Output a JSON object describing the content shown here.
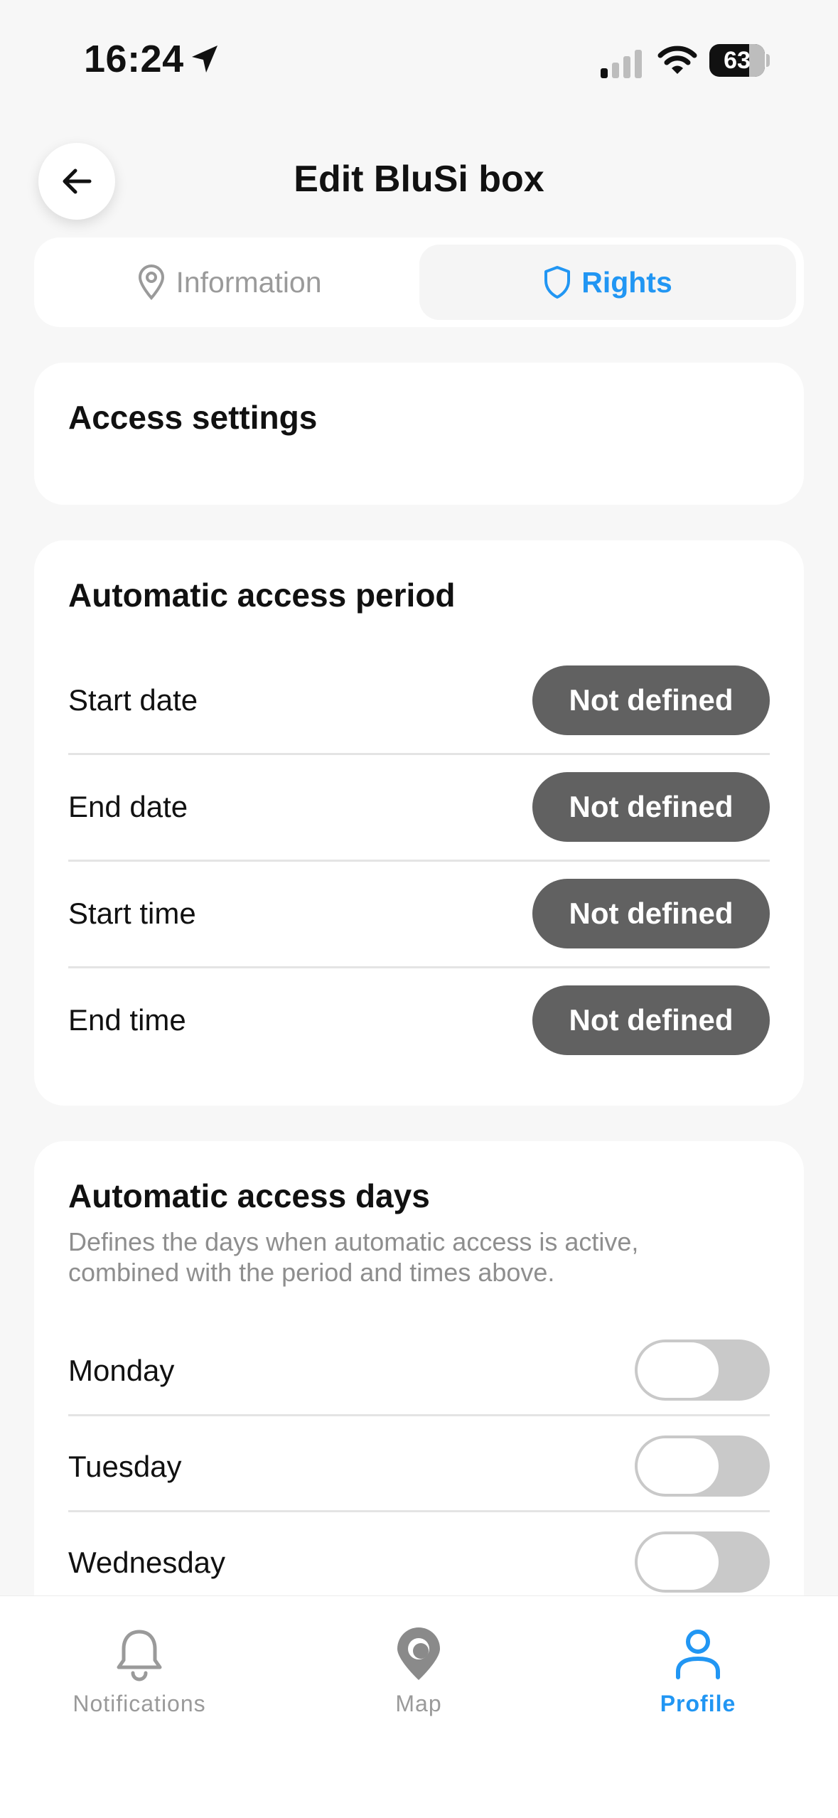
{
  "status_bar": {
    "time": "16:24",
    "battery": "63"
  },
  "header": {
    "title": "Edit BluSi box"
  },
  "tabs": [
    {
      "label": "Information",
      "active": false
    },
    {
      "label": "Rights",
      "active": true
    }
  ],
  "access_settings": {
    "title": "Access settings"
  },
  "access_period": {
    "title": "Automatic access period",
    "rows": [
      {
        "label": "Start date",
        "value": "Not defined"
      },
      {
        "label": "End date",
        "value": "Not defined"
      },
      {
        "label": "Start time",
        "value": "Not defined"
      },
      {
        "label": "End time",
        "value": "Not defined"
      }
    ]
  },
  "access_days": {
    "title": "Automatic access days",
    "description": "Defines the days when automatic access is active, combined with the period and times above.",
    "days": [
      {
        "label": "Monday",
        "enabled": false
      },
      {
        "label": "Tuesday",
        "enabled": false
      },
      {
        "label": "Wednesday",
        "enabled": false
      }
    ]
  },
  "bottom_nav": {
    "items": [
      {
        "label": "Notifications",
        "icon": "bell-icon",
        "active": false
      },
      {
        "label": "Map",
        "icon": "map-pin-icon",
        "active": false
      },
      {
        "label": "Profile",
        "icon": "profile-icon",
        "active": true
      }
    ]
  },
  "colors": {
    "accent": "#2196f3",
    "pill": "#616161",
    "inactive": "#9a9a9a"
  }
}
